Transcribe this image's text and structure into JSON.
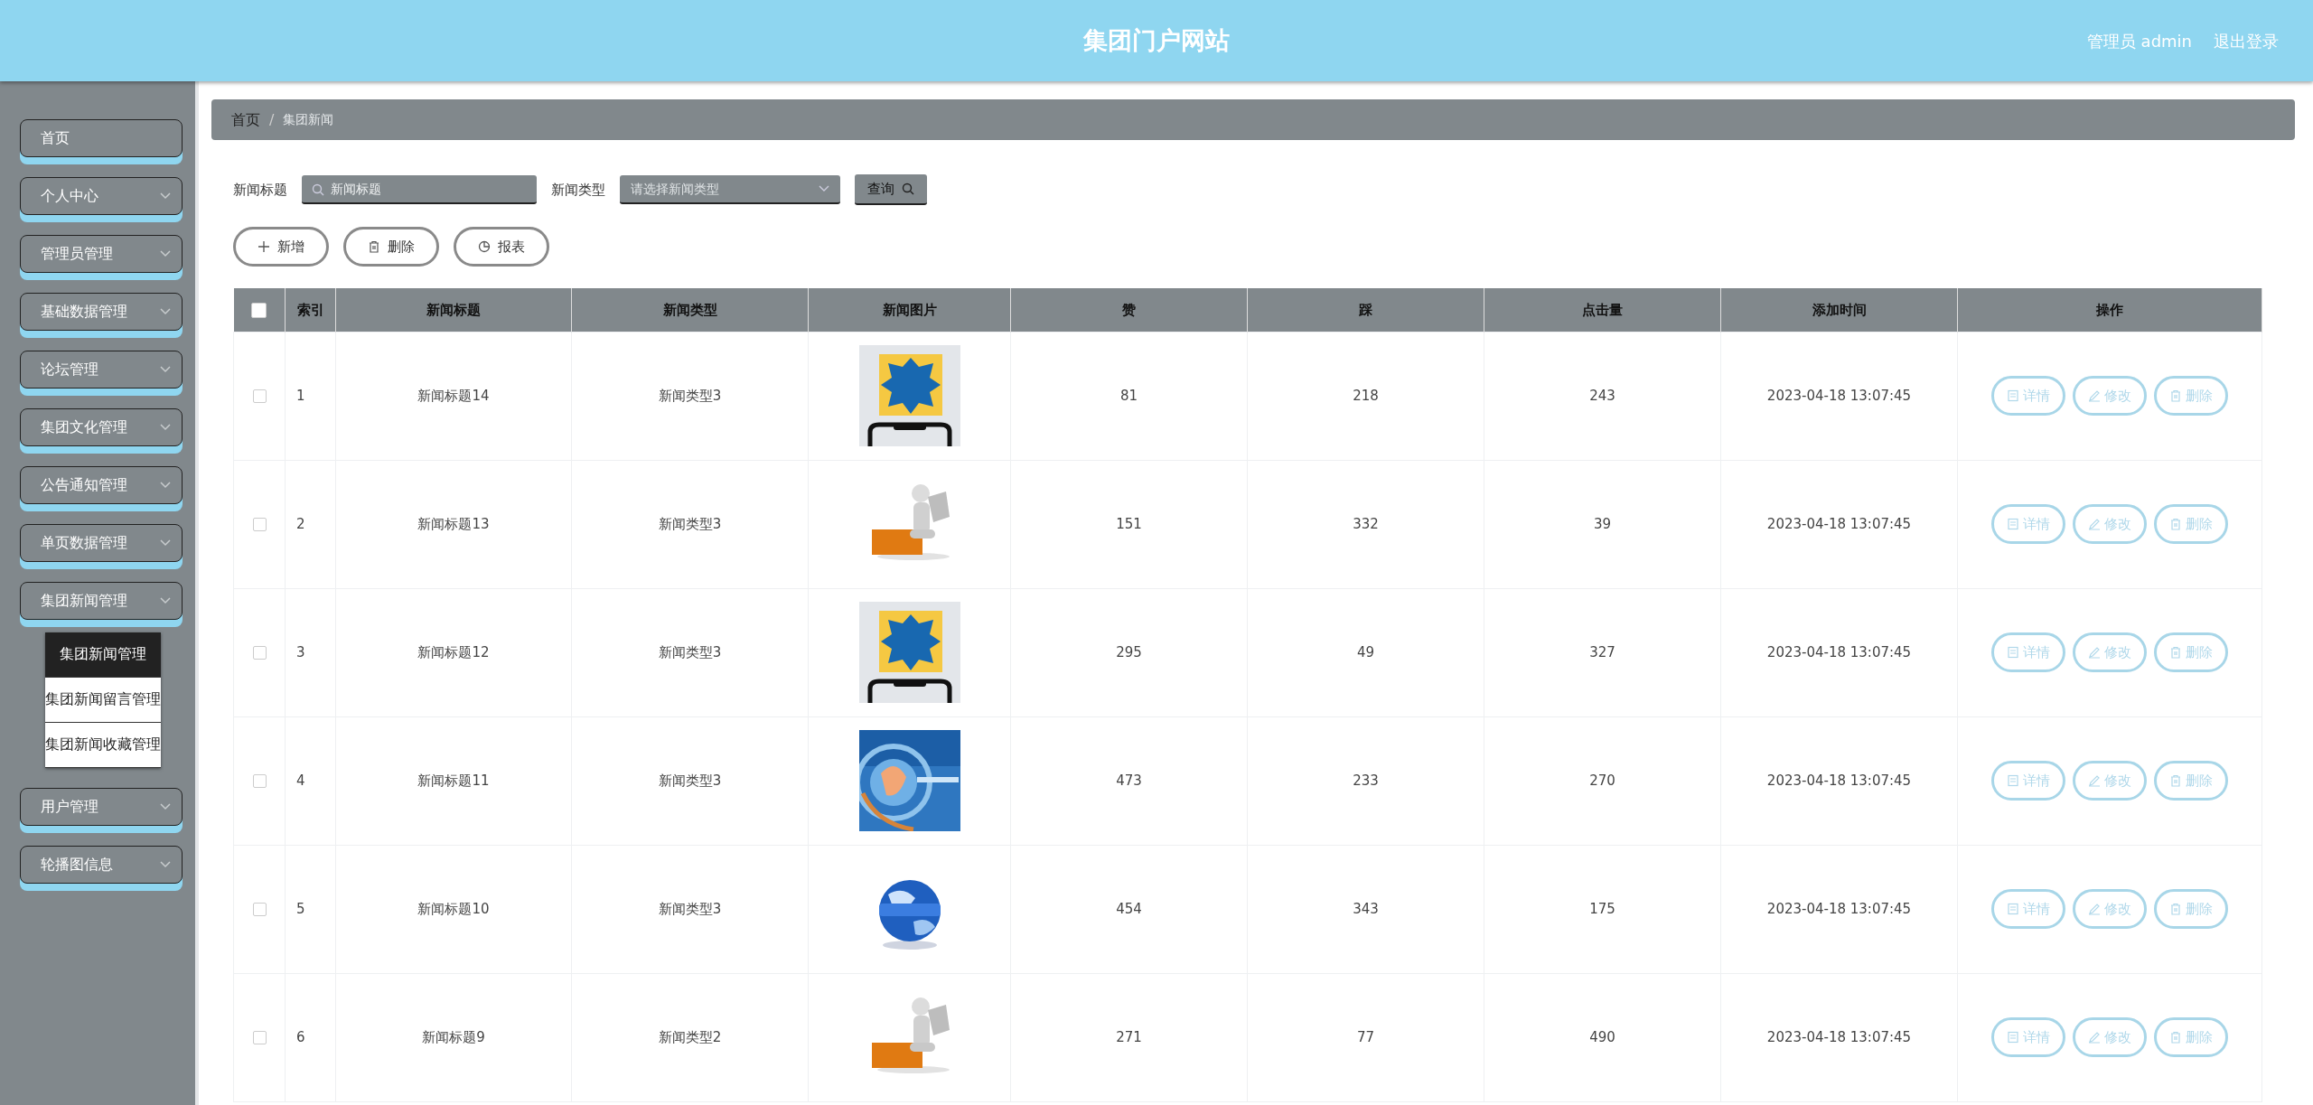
{
  "header": {
    "title": "集团门户网站",
    "user": "管理员 admin",
    "logout": "退出登录"
  },
  "sidebar": {
    "items": [
      {
        "label": "首页",
        "kind": "link"
      },
      {
        "label": "个人中心",
        "kind": "group"
      },
      {
        "label": "管理员管理",
        "kind": "group"
      },
      {
        "label": "基础数据管理",
        "kind": "group"
      },
      {
        "label": "论坛管理",
        "kind": "group"
      },
      {
        "label": "集团文化管理",
        "kind": "group"
      },
      {
        "label": "公告通知管理",
        "kind": "group"
      },
      {
        "label": "单页数据管理",
        "kind": "group"
      },
      {
        "label": "集团新闻管理",
        "kind": "group",
        "children": [
          {
            "label": "集团新闻管理",
            "selected": true
          },
          {
            "label": "集团新闻留言管理",
            "selected": false
          },
          {
            "label": "集团新闻收藏管理",
            "selected": false
          }
        ]
      },
      {
        "label": "用户管理",
        "kind": "group"
      },
      {
        "label": "轮播图信息",
        "kind": "group"
      }
    ]
  },
  "breadcrumb": {
    "items": [
      "首页",
      "集团新闻"
    ],
    "separator": "/"
  },
  "filters": {
    "title_label": "新闻标题",
    "title_placeholder": "新闻标题",
    "type_label": "新闻类型",
    "type_placeholder": "请选择新闻类型",
    "search_button": "查询"
  },
  "actions": [
    "新增",
    "删除",
    "报表"
  ],
  "table": {
    "select_all_checked": false,
    "columns": [
      "索引",
      "新闻标题",
      "新闻类型",
      "新闻图片",
      "赞",
      "踩",
      "点击量",
      "添加时间",
      "操作"
    ],
    "rows": [
      {
        "checked": false,
        "index": "1",
        "title": "新闻标题14",
        "type": "新闻类型3",
        "likes": "81",
        "dislikes": "218",
        "clicks": "243",
        "time": "2023-04-18 13:07:45",
        "buttons": [
          "详情",
          "修改",
          "删除"
        ]
      },
      {
        "checked": false,
        "index": "2",
        "title": "新闻标题13",
        "type": "新闻类型3",
        "likes": "151",
        "dislikes": "332",
        "clicks": "39",
        "time": "2023-04-18 13:07:45",
        "buttons": [
          "详情",
          "修改",
          "删除"
        ]
      },
      {
        "checked": false,
        "index": "3",
        "title": "新闻标题12",
        "type": "新闻类型3",
        "likes": "295",
        "dislikes": "49",
        "clicks": "327",
        "time": "2023-04-18 13:07:45",
        "buttons": [
          "详情",
          "修改",
          "删除"
        ]
      },
      {
        "checked": false,
        "index": "4",
        "title": "新闻标题11",
        "type": "新闻类型3",
        "likes": "473",
        "dislikes": "233",
        "clicks": "270",
        "time": "2023-04-18 13:07:45",
        "buttons": [
          "详情",
          "修改",
          "删除"
        ]
      },
      {
        "checked": false,
        "index": "5",
        "title": "新闻标题10",
        "type": "新闻类型3",
        "likes": "454",
        "dislikes": "343",
        "clicks": "175",
        "time": "2023-04-18 13:07:45",
        "buttons": [
          "详情",
          "修改",
          "删除"
        ]
      },
      {
        "checked": false,
        "index": "6",
        "title": "新闻标题9",
        "type": "新闻类型2",
        "likes": "271",
        "dislikes": "77",
        "clicks": "490",
        "time": "2023-04-18 13:07:45",
        "buttons": [
          "详情",
          "修改",
          "删除"
        ]
      }
    ]
  }
}
